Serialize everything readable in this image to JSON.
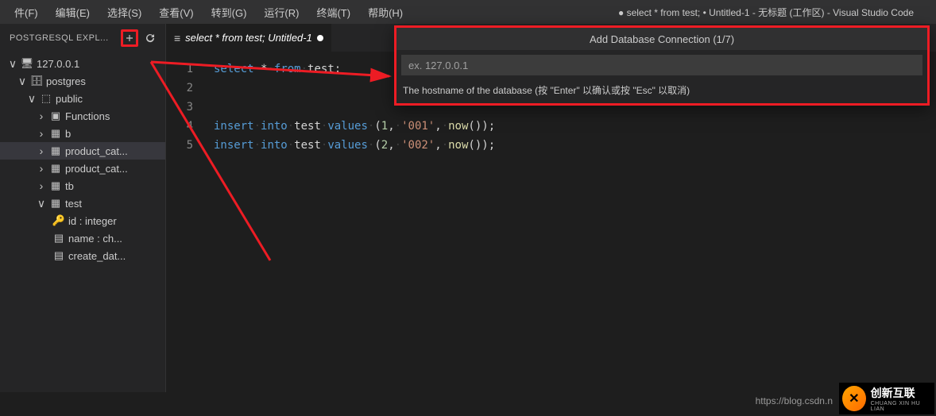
{
  "menubar": {
    "items": [
      {
        "label": "件(F)"
      },
      {
        "label": "编辑(E)"
      },
      {
        "label": "选择(S)"
      },
      {
        "label": "查看(V)"
      },
      {
        "label": "转到(G)"
      },
      {
        "label": "运行(R)"
      },
      {
        "label": "终端(T)"
      },
      {
        "label": "帮助(H)"
      }
    ],
    "title": "● select * from test; • Untitled-1 - 无标题 (工作区) - Visual Studio Code"
  },
  "sidebar": {
    "title": "POSTGRESQL EXPL...",
    "tree": [
      {
        "indent": 8,
        "chev": "∨",
        "icon": "server",
        "label": "127.0.0.1"
      },
      {
        "indent": 20,
        "chev": "∨",
        "icon": "database",
        "label": "postgres"
      },
      {
        "indent": 32,
        "chev": "∨",
        "icon": "schema",
        "label": "public"
      },
      {
        "indent": 44,
        "chev": "›",
        "icon": "folder",
        "label": "Functions"
      },
      {
        "indent": 44,
        "chev": "›",
        "icon": "table",
        "label": "b"
      },
      {
        "indent": 44,
        "chev": "›",
        "icon": "table",
        "label": "product_cat...",
        "selected": true
      },
      {
        "indent": 44,
        "chev": "›",
        "icon": "table",
        "label": "product_cat..."
      },
      {
        "indent": 44,
        "chev": "›",
        "icon": "table",
        "label": "tb"
      },
      {
        "indent": 44,
        "chev": "∨",
        "icon": "table",
        "label": "test"
      },
      {
        "indent": 64,
        "chev": "",
        "icon": "key",
        "label": "id : integer"
      },
      {
        "indent": 64,
        "chev": "",
        "icon": "column",
        "label": "name : ch..."
      },
      {
        "indent": 64,
        "chev": "",
        "icon": "column",
        "label": "create_dat..."
      }
    ]
  },
  "tab": {
    "title": "select * from test;  Untitled-1"
  },
  "gutter": [
    "1",
    "2",
    "3",
    "4",
    "5"
  ],
  "quickinput": {
    "title": "Add Database Connection (1/7)",
    "placeholder": "ex. 127.0.0.1",
    "hint": "The hostname of the database (按 \"Enter\" 以确认或按 \"Esc\" 以取消)"
  },
  "status": {
    "url": "https://blog.csdn.n"
  },
  "logo": {
    "text": "创新互联",
    "sub": "CHUANG XIN HU LIAN"
  },
  "code": {
    "line1": {
      "sel": "select",
      "star": "*",
      "from": "from",
      "tbl": "test",
      "semi": ";"
    },
    "line4": {
      "ins": "insert",
      "into": "into",
      "tbl": "test",
      "vals": "values",
      "lp": "(",
      "n": "1",
      "c": ",",
      "s": "'001'",
      "fn": "now",
      "rp": "())",
      "semi": ";"
    },
    "line5": {
      "ins": "insert",
      "into": "into",
      "tbl": "test",
      "vals": "values",
      "lp": "(",
      "n": "2",
      "c": ",",
      "s": "'002'",
      "fn": "now",
      "rp": "())",
      "semi": ";"
    }
  }
}
